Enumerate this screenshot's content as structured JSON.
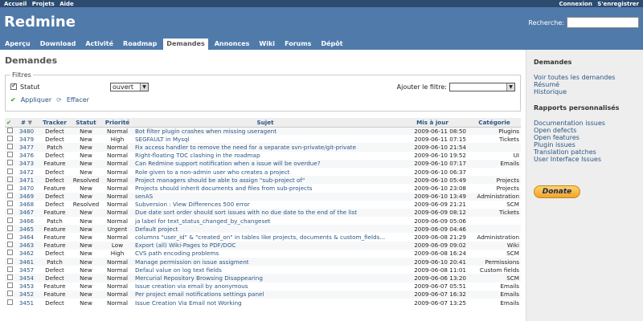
{
  "top_menu": {
    "left": [
      "Accueil",
      "Projets",
      "Aide"
    ],
    "right": [
      "Connexion",
      "S'enregistrer"
    ]
  },
  "header": {
    "title": "Redmine",
    "search_label": "Recherche:"
  },
  "tabs": [
    "Aperçu",
    "Download",
    "Activité",
    "Roadmap",
    "Demandes",
    "Annonces",
    "Wiki",
    "Forums",
    "Dépôt"
  ],
  "page_title": "Demandes",
  "filters": {
    "legend": "Filtres",
    "status_label": "Statut",
    "status_value": "ouvert",
    "add_filter_label": "Ajouter le filtre:",
    "apply": "Appliquer",
    "clear": "Effacer"
  },
  "table": {
    "headers": [
      "#",
      "Tracker",
      "Statut",
      "Priorité",
      "Sujet",
      "Mis à jour",
      "Catégorie"
    ],
    "rows": [
      [
        "3480",
        "Defect",
        "New",
        "Normal",
        "Bot filter plugin crashes when missing useragent",
        "2009-06-11 08:50",
        "Plugins"
      ],
      [
        "3479",
        "Defect",
        "New",
        "High",
        "SEGFAULT in Mysql",
        "2009-06-11 07:15",
        "Tickets"
      ],
      [
        "3477",
        "Patch",
        "New",
        "Normal",
        "Fix access handler to remove the need for a separate svn-private/git-private",
        "2009-06-10 21:54",
        ""
      ],
      [
        "3476",
        "Defect",
        "New",
        "Normal",
        "Right-floating TOC clashing in the roadmap",
        "2009-06-10 19:52",
        "UI"
      ],
      [
        "3473",
        "Feature",
        "New",
        "Normal",
        "Can Redmine support notification when a issue will be overdue?",
        "2009-06-10 07:17",
        "Emails"
      ],
      [
        "3472",
        "Defect",
        "New",
        "Normal",
        "Role given to a non-admin user who creates a project",
        "2009-06-10 06:37",
        ""
      ],
      [
        "3471",
        "Defect",
        "Resolved",
        "Normal",
        "Project managers should be able to assign \"sub-project of\"",
        "2009-06-10 05:49",
        "Projects"
      ],
      [
        "3470",
        "Feature",
        "New",
        "Normal",
        "Projects should inherit documents and files from sub-projects",
        "2009-06-10 23:08",
        "Projects"
      ],
      [
        "3469",
        "Defect",
        "New",
        "Normal",
        "senAS",
        "2009-06-10 13:49",
        "Administration"
      ],
      [
        "3468",
        "Defect",
        "Resolved",
        "Normal",
        "Subversion : View Differences 500 error",
        "2009-06-09 21:21",
        "SCM"
      ],
      [
        "3467",
        "Feature",
        "New",
        "Normal",
        "Due date sort order should sort issues with no due date to the end of the list",
        "2009-06-09 08:12",
        "Tickets"
      ],
      [
        "3466",
        "Patch",
        "New",
        "Normal",
        "ja label for text_status_changed_by_changeset",
        "2009-06-09 05:06",
        ""
      ],
      [
        "3465",
        "Feature",
        "New",
        "Urgent",
        "Default project",
        "2009-06-09 04:46",
        ""
      ],
      [
        "3464",
        "Feature",
        "New",
        "Normal",
        "columns \"user_id\" & \"created_on\" in tables like projects, documents & custom_fields...",
        "2009-06-08 21:29",
        "Administration"
      ],
      [
        "3463",
        "Feature",
        "New",
        "Low",
        "Export (all) Wiki-Pages to PDF/DOC",
        "2009-06-09 09:02",
        "Wiki"
      ],
      [
        "3462",
        "Defect",
        "New",
        "High",
        "CVS path encoding problems",
        "2009-06-08 16:24",
        "SCM"
      ],
      [
        "3461",
        "Patch",
        "New",
        "Normal",
        "Manage permission on issue assigment",
        "2009-06-10 20:41",
        "Permissions"
      ],
      [
        "3457",
        "Defect",
        "New",
        "Normal",
        "Defaul value on log text fields",
        "2009-06-08 11:01",
        "Custom fields"
      ],
      [
        "3454",
        "Defect",
        "New",
        "Normal",
        "Mercurial Repository Browsing Disappearing",
        "2009-06-06 13:20",
        "SCM"
      ],
      [
        "3453",
        "Feature",
        "New",
        "Normal",
        "Issue creation via email by anonymous",
        "2009-06-07 05:51",
        "Emails"
      ],
      [
        "3452",
        "Feature",
        "New",
        "Normal",
        "Per project email notifications settings panel",
        "2009-06-07 16:32",
        "Emails"
      ],
      [
        "3451",
        "Defect",
        "New",
        "Normal",
        "Issue Creation Via Email not Working",
        "2009-06-07 13:25",
        "Emails"
      ]
    ]
  },
  "sidebar": {
    "title": "Demandes",
    "links": [
      "Voir toutes les demandes",
      "Résumé",
      "Historique"
    ],
    "custom_title": "Rapports personnalisés",
    "custom_links": [
      "Documentation issues",
      "Open defects",
      "Open features",
      "Plugin issues",
      "Translation patches",
      "User Interface Issues"
    ],
    "donate": "Donate"
  }
}
